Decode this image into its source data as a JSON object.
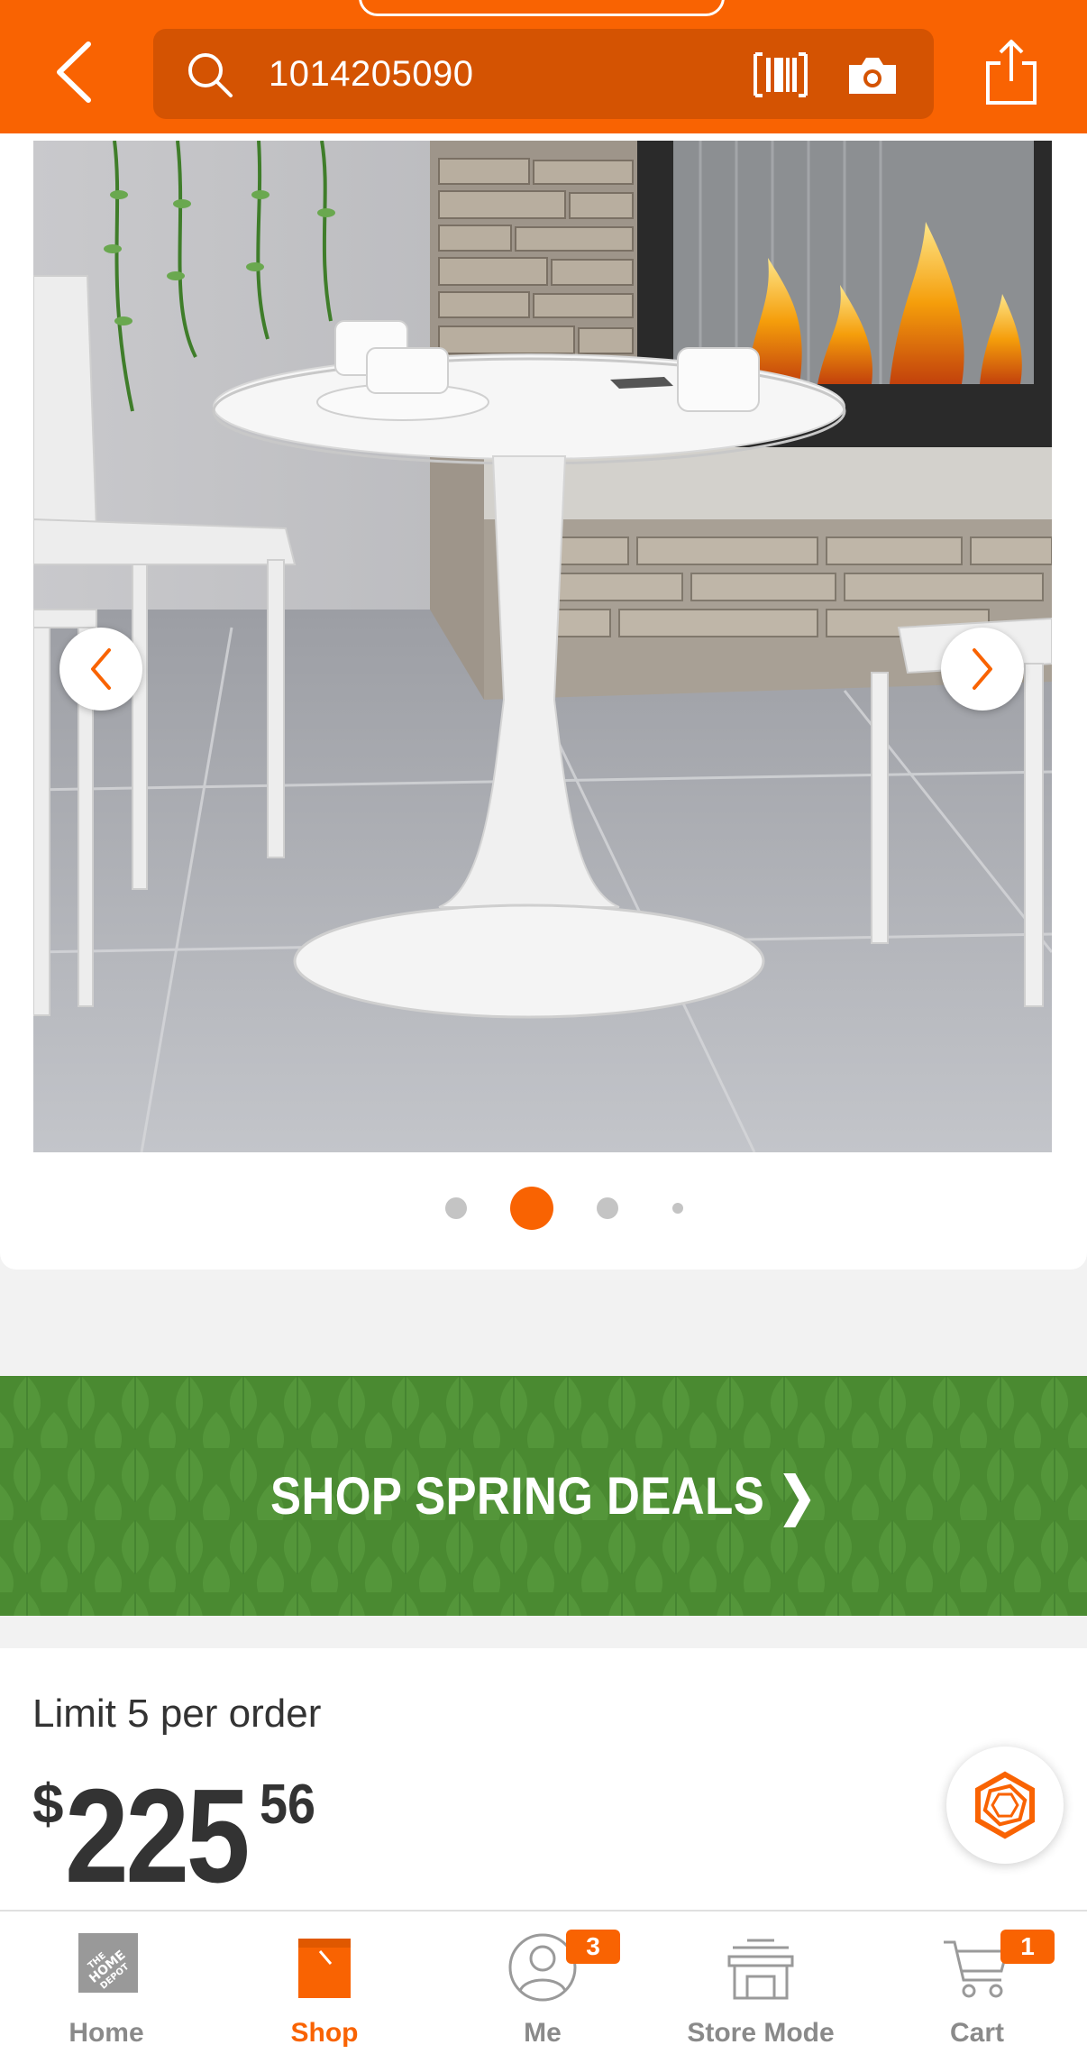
{
  "header": {
    "search_value": "1014205090"
  },
  "gallery": {
    "slide_count": 4,
    "active_index": 1
  },
  "banner": {
    "text": "SHOP SPRING DEALS ❯"
  },
  "product": {
    "limit_text": "Limit 5 per order",
    "price_symbol": "$",
    "price_dollars": "225",
    "price_cents": "56"
  },
  "tabbar": {
    "items": [
      {
        "label": "Home",
        "icon": "home-depot-logo-icon"
      },
      {
        "label": "Shop",
        "icon": "shopping-bag-icon"
      },
      {
        "label": "Me",
        "icon": "user-icon",
        "badge": "3"
      },
      {
        "label": "Store Mode",
        "icon": "store-icon"
      },
      {
        "label": "Cart",
        "icon": "cart-icon",
        "badge": "1"
      }
    ]
  },
  "colors": {
    "brand_orange": "#f96302",
    "banner_green": "#4a8a31",
    "text_dark": "#333333",
    "tab_inactive": "#8a8a8a"
  }
}
